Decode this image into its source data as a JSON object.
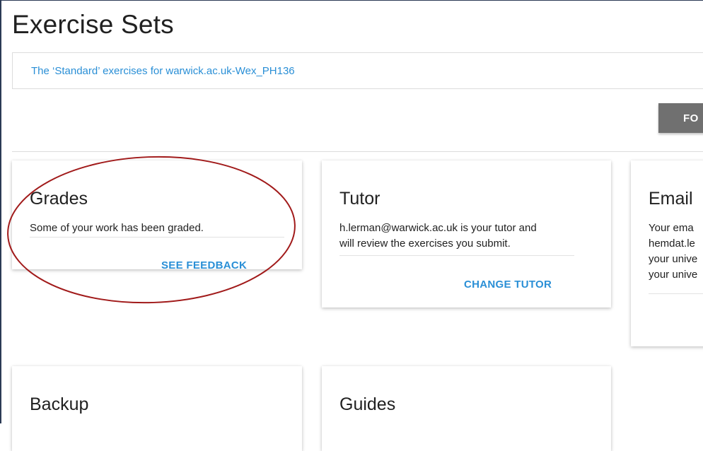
{
  "page": {
    "title": "Exercise Sets"
  },
  "exercise_set": {
    "link_text": "The ‘Standard’ exercises for warwick.ac.uk-Wex_PH136"
  },
  "toolbar": {
    "button_label": "FO"
  },
  "cards": {
    "grades": {
      "title": "Grades",
      "text": "Some of your work has been graded.",
      "action": "SEE FEEDBACK"
    },
    "tutor": {
      "title": "Tutor",
      "text_line1": "h.lerman@warwick.ac.uk is your tutor and",
      "text_line2": "will review the exercises you submit.",
      "action": "CHANGE TUTOR"
    },
    "email": {
      "title": "Email",
      "text_line1": "Your ema",
      "text_line2": "hemdat.le",
      "text_line3": "your unive",
      "text_line4": "your unive"
    },
    "backup": {
      "title": "Backup"
    },
    "guides": {
      "title": "Guides"
    }
  },
  "colors": {
    "link_blue": "#2a8fd6",
    "button_gray": "#707070",
    "annotation_red": "#a11a1a"
  }
}
